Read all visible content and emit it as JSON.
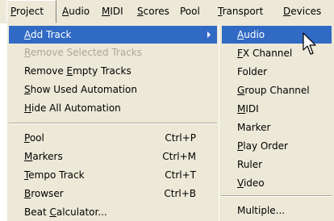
{
  "menubar": {
    "items": [
      {
        "label": "Project",
        "underline": "P"
      },
      {
        "label": "Audio",
        "underline": "A"
      },
      {
        "label": "MIDI",
        "underline": "M"
      },
      {
        "label": "Scores",
        "underline": "S"
      },
      {
        "label": "Pool",
        "underline": ""
      },
      {
        "label": "Transport",
        "underline": "T"
      },
      {
        "label": "Devices",
        "underline": "D"
      }
    ]
  },
  "project_menu": {
    "items": [
      {
        "label": "Add Track",
        "shortcut": "",
        "state": "highlighted",
        "has_submenu": true
      },
      {
        "label": "Remove Selected Tracks",
        "shortcut": "",
        "state": "disabled"
      },
      {
        "label": "Remove Empty Tracks",
        "shortcut": "",
        "state": "normal"
      },
      {
        "label": "Show Used Automation",
        "shortcut": "",
        "state": "normal"
      },
      {
        "label": "Hide All Automation",
        "shortcut": "",
        "state": "normal"
      },
      {
        "label": "Pool",
        "shortcut": "Ctrl+P",
        "state": "normal"
      },
      {
        "label": "Markers",
        "shortcut": "Ctrl+M",
        "state": "normal"
      },
      {
        "label": "Tempo Track",
        "shortcut": "Ctrl+T",
        "state": "normal"
      },
      {
        "label": "Browser",
        "shortcut": "Ctrl+B",
        "state": "normal"
      },
      {
        "label": "Beat Calculator...",
        "shortcut": "",
        "state": "normal"
      }
    ]
  },
  "add_track_submenu": {
    "items": [
      {
        "label": "Audio",
        "state": "highlighted"
      },
      {
        "label": "FX Channel",
        "state": "normal"
      },
      {
        "label": "Folder",
        "state": "normal"
      },
      {
        "label": "Group Channel",
        "state": "normal"
      },
      {
        "label": "MIDI",
        "state": "normal"
      },
      {
        "label": "Marker",
        "state": "normal"
      },
      {
        "label": "Play Order",
        "state": "normal"
      },
      {
        "label": "Ruler",
        "state": "normal"
      },
      {
        "label": "Video",
        "state": "normal"
      },
      {
        "label": "Multiple...",
        "state": "normal"
      }
    ]
  },
  "colors": {
    "menu_background": "#ece9d8",
    "highlight": "#316ac5",
    "disabled_text": "#aca899"
  },
  "cursor": {
    "icon": "arrow-pointer-icon"
  }
}
